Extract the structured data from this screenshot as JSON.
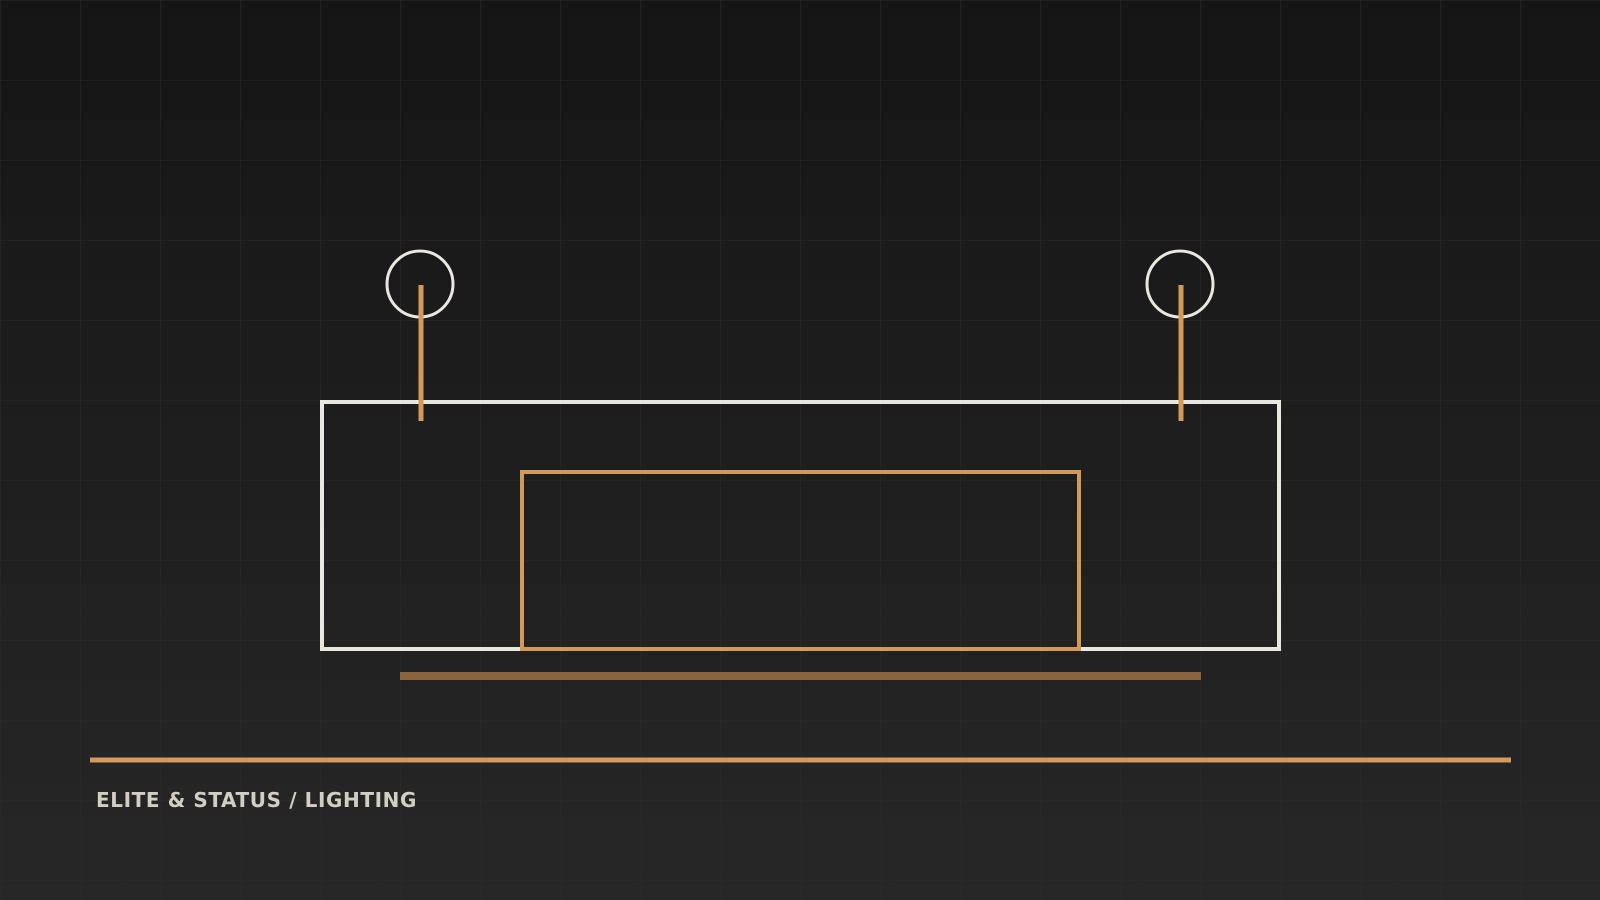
{
  "caption": "ELITE & STATUS / LIGHTING",
  "colors": {
    "background_top": "#151515",
    "background_bottom": "#272727",
    "grid": "#2c2c2c",
    "outline_light": "#ebe7df",
    "accent": "#d19a5a",
    "accent_dark": "#8a6440",
    "caption_text": "#d4cdc2"
  },
  "icons": [
    "pendant-lamp-left-icon",
    "pendant-lamp-right-icon"
  ]
}
